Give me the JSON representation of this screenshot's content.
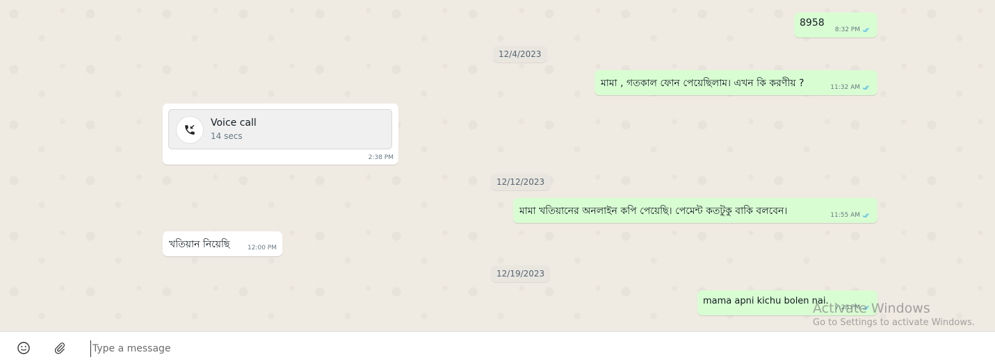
{
  "messages": {
    "m1": {
      "text": "8958",
      "time": "8:32 PM"
    },
    "m2": {
      "text": "মামা , গতকাল ফোন পেয়েছিলাম। এখন কি করণীয় ?",
      "time": "11:32 AM"
    },
    "m3": {
      "call_title": "Voice call",
      "call_duration": "14 secs",
      "time": "2:38 PM"
    },
    "m4": {
      "text": "মামা খতিয়ানের অনলাইন কপি পেয়েছি। পেমেন্ট কতটুকু  বাকি  বলবেন।",
      "time": "11:55 AM"
    },
    "m5": {
      "text": "খতিয়ান নিয়েছি",
      "time": "12:00 PM"
    },
    "m6": {
      "text": "mama apni kichu bolen nai.",
      "time": "7:28 PM"
    }
  },
  "dates": {
    "d1": "12/4/2023",
    "d2": "12/12/2023",
    "d3": "12/19/2023"
  },
  "composer": {
    "placeholder": "Type a message"
  },
  "watermark": {
    "title": "Activate Windows",
    "subtitle": "Go to Settings to activate Windows."
  },
  "colors": {
    "outgoing_bubble": "#d9fdd3",
    "incoming_bubble": "#ffffff",
    "read_tick": "#53bdeb",
    "chat_background": "#efeae2"
  },
  "icons": {
    "emoji": "emoji-icon",
    "attach": "paperclip-icon",
    "call": "phone-incoming-icon",
    "read": "double-check-icon"
  }
}
